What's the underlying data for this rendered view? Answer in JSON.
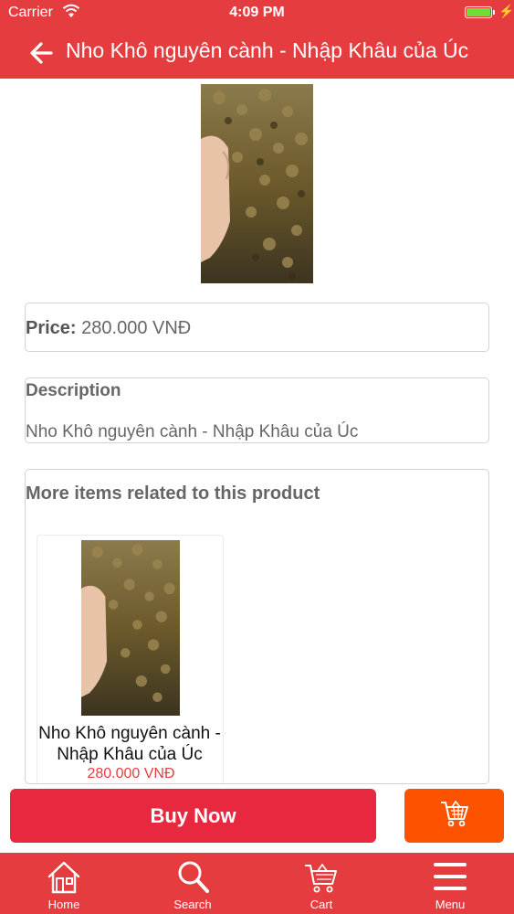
{
  "status_bar": {
    "carrier": "Carrier",
    "time": "4:09 PM",
    "icons": [
      "wifi-icon",
      "battery-icon",
      "charging-bolt-icon"
    ],
    "battery_color": "#6fdc3a"
  },
  "header": {
    "title": "Nho Khô nguyên cành - Nhập Khâu  của  Úc",
    "back_icon": "arrow-left-icon",
    "background_color": "#e53d3f"
  },
  "product": {
    "image_icon": "raisin-photo",
    "price_label": "Price:",
    "price_value": "280.000 VNĐ",
    "description_heading": "Description",
    "description_text": "Nho Khô nguyên cành - Nhập Khâu của Úc"
  },
  "related": {
    "heading": "More items related to this product",
    "items": [
      {
        "name": "Nho Khô nguyên cành - Nhập Khâu  của  Úc",
        "price": "280.000 VNĐ"
      }
    ]
  },
  "actions": {
    "buy_now_label": "Buy Now",
    "buy_now_color": "#e7283f",
    "cart_icon": "shopping-cart-icon",
    "cart_button_color": "#fd5300"
  },
  "tab_bar": {
    "tabs": [
      {
        "label": "Home",
        "icon": "home-icon"
      },
      {
        "label": "Search",
        "icon": "search-icon"
      },
      {
        "label": "Cart",
        "icon": "cart-icon"
      },
      {
        "label": "Menu",
        "icon": "menu-icon"
      }
    ]
  }
}
